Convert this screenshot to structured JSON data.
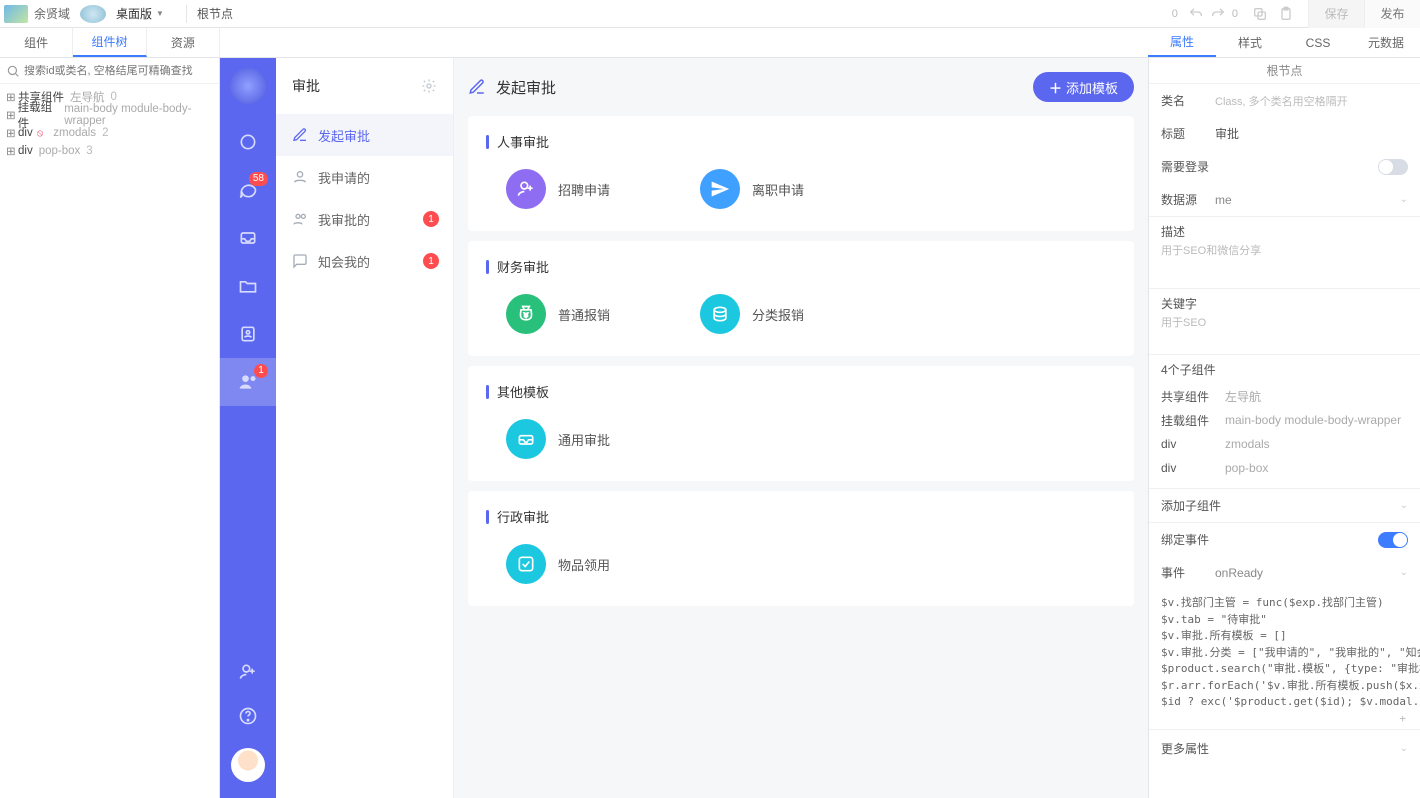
{
  "topbar": {
    "username": "余贤域",
    "device": "桌面版",
    "root_label": "根节点",
    "undo_count": "0",
    "redo_count": "0",
    "save": "保存",
    "publish": "发布"
  },
  "left_tabs": {
    "t1": "组件",
    "t2": "组件树",
    "t3": "资源"
  },
  "right_tabs": {
    "t1": "属性",
    "t2": "样式",
    "t3": "CSS",
    "t4": "元数据"
  },
  "search": {
    "placeholder": "搜索id或类名, 空格结尾可精确查找"
  },
  "tree": {
    "n1": {
      "label": "共享组件",
      "sub": "左导航",
      "count": "0"
    },
    "n2": {
      "label": "挂载组件",
      "sub": "main-body module-body-wrapper"
    },
    "n3": {
      "label": "div",
      "sub": "zmodals",
      "count": "2"
    },
    "n4": {
      "label": "div",
      "sub": "pop-box",
      "count": "3"
    }
  },
  "app": {
    "chat_badge": "58",
    "people_badge": "1",
    "sub_title": "审批",
    "menu": {
      "m1": "发起审批",
      "m2": "我申请的",
      "m3": "我审批的",
      "m3_badge": "1",
      "m4": "知会我的",
      "m4_badge": "1"
    },
    "content": {
      "title": "发起审批",
      "add_template": "添加模板",
      "sections": {
        "s1": {
          "title": "人事审批",
          "c1": "招聘申请",
          "c2": "离职申请"
        },
        "s2": {
          "title": "财务审批",
          "c1": "普通报销",
          "c2": "分类报销"
        },
        "s3": {
          "title": "其他模板",
          "c1": "通用审批"
        },
        "s4": {
          "title": "行政审批",
          "c1": "物品领用"
        }
      }
    }
  },
  "props": {
    "crumb": "根节点",
    "class_label": "类名",
    "class_hint": "Class, 多个类名用空格隔开",
    "title_label": "标题",
    "title_value": "审批",
    "need_login": "需要登录",
    "datasource_label": "数据源",
    "datasource_value": "me",
    "desc_label": "描述",
    "desc_hint": "用于SEO和微信分享",
    "keyword_label": "关键字",
    "keyword_hint": "用于SEO",
    "children_title": "4个子组件",
    "children": {
      "c1k": "共享组件",
      "c1v": "左导航",
      "c2k": "挂载组件",
      "c2v": "main-body module-body-wrapper",
      "c3k": "div",
      "c3v": "zmodals",
      "c4k": "div",
      "c4v": "pop-box"
    },
    "add_child": "添加子组件",
    "bind_event": "绑定事件",
    "event_label": "事件",
    "event_value": "onReady",
    "code": {
      "l1": "$v.找部门主管 = func($exp.找部门主管)",
      "l2": "$v.tab = \"待审批\"",
      "l3": "$v.审批.所有模板 = []",
      "l4": "$v.审批.分类 = [\"我申请的\", \"我审批的\", \"知会我的\"]",
      "l5": "$product.search(\"审批.模板\", {type: \"审批模板\", \"x.关",
      "l6": "$r.arr.forEach('$v.审批.所有模板.push($x.x.名称); $l.结",
      "l7": "$id ? exc('$product.get($id); $v.modal.key = \"审批\""
    },
    "more": "更多属性"
  }
}
